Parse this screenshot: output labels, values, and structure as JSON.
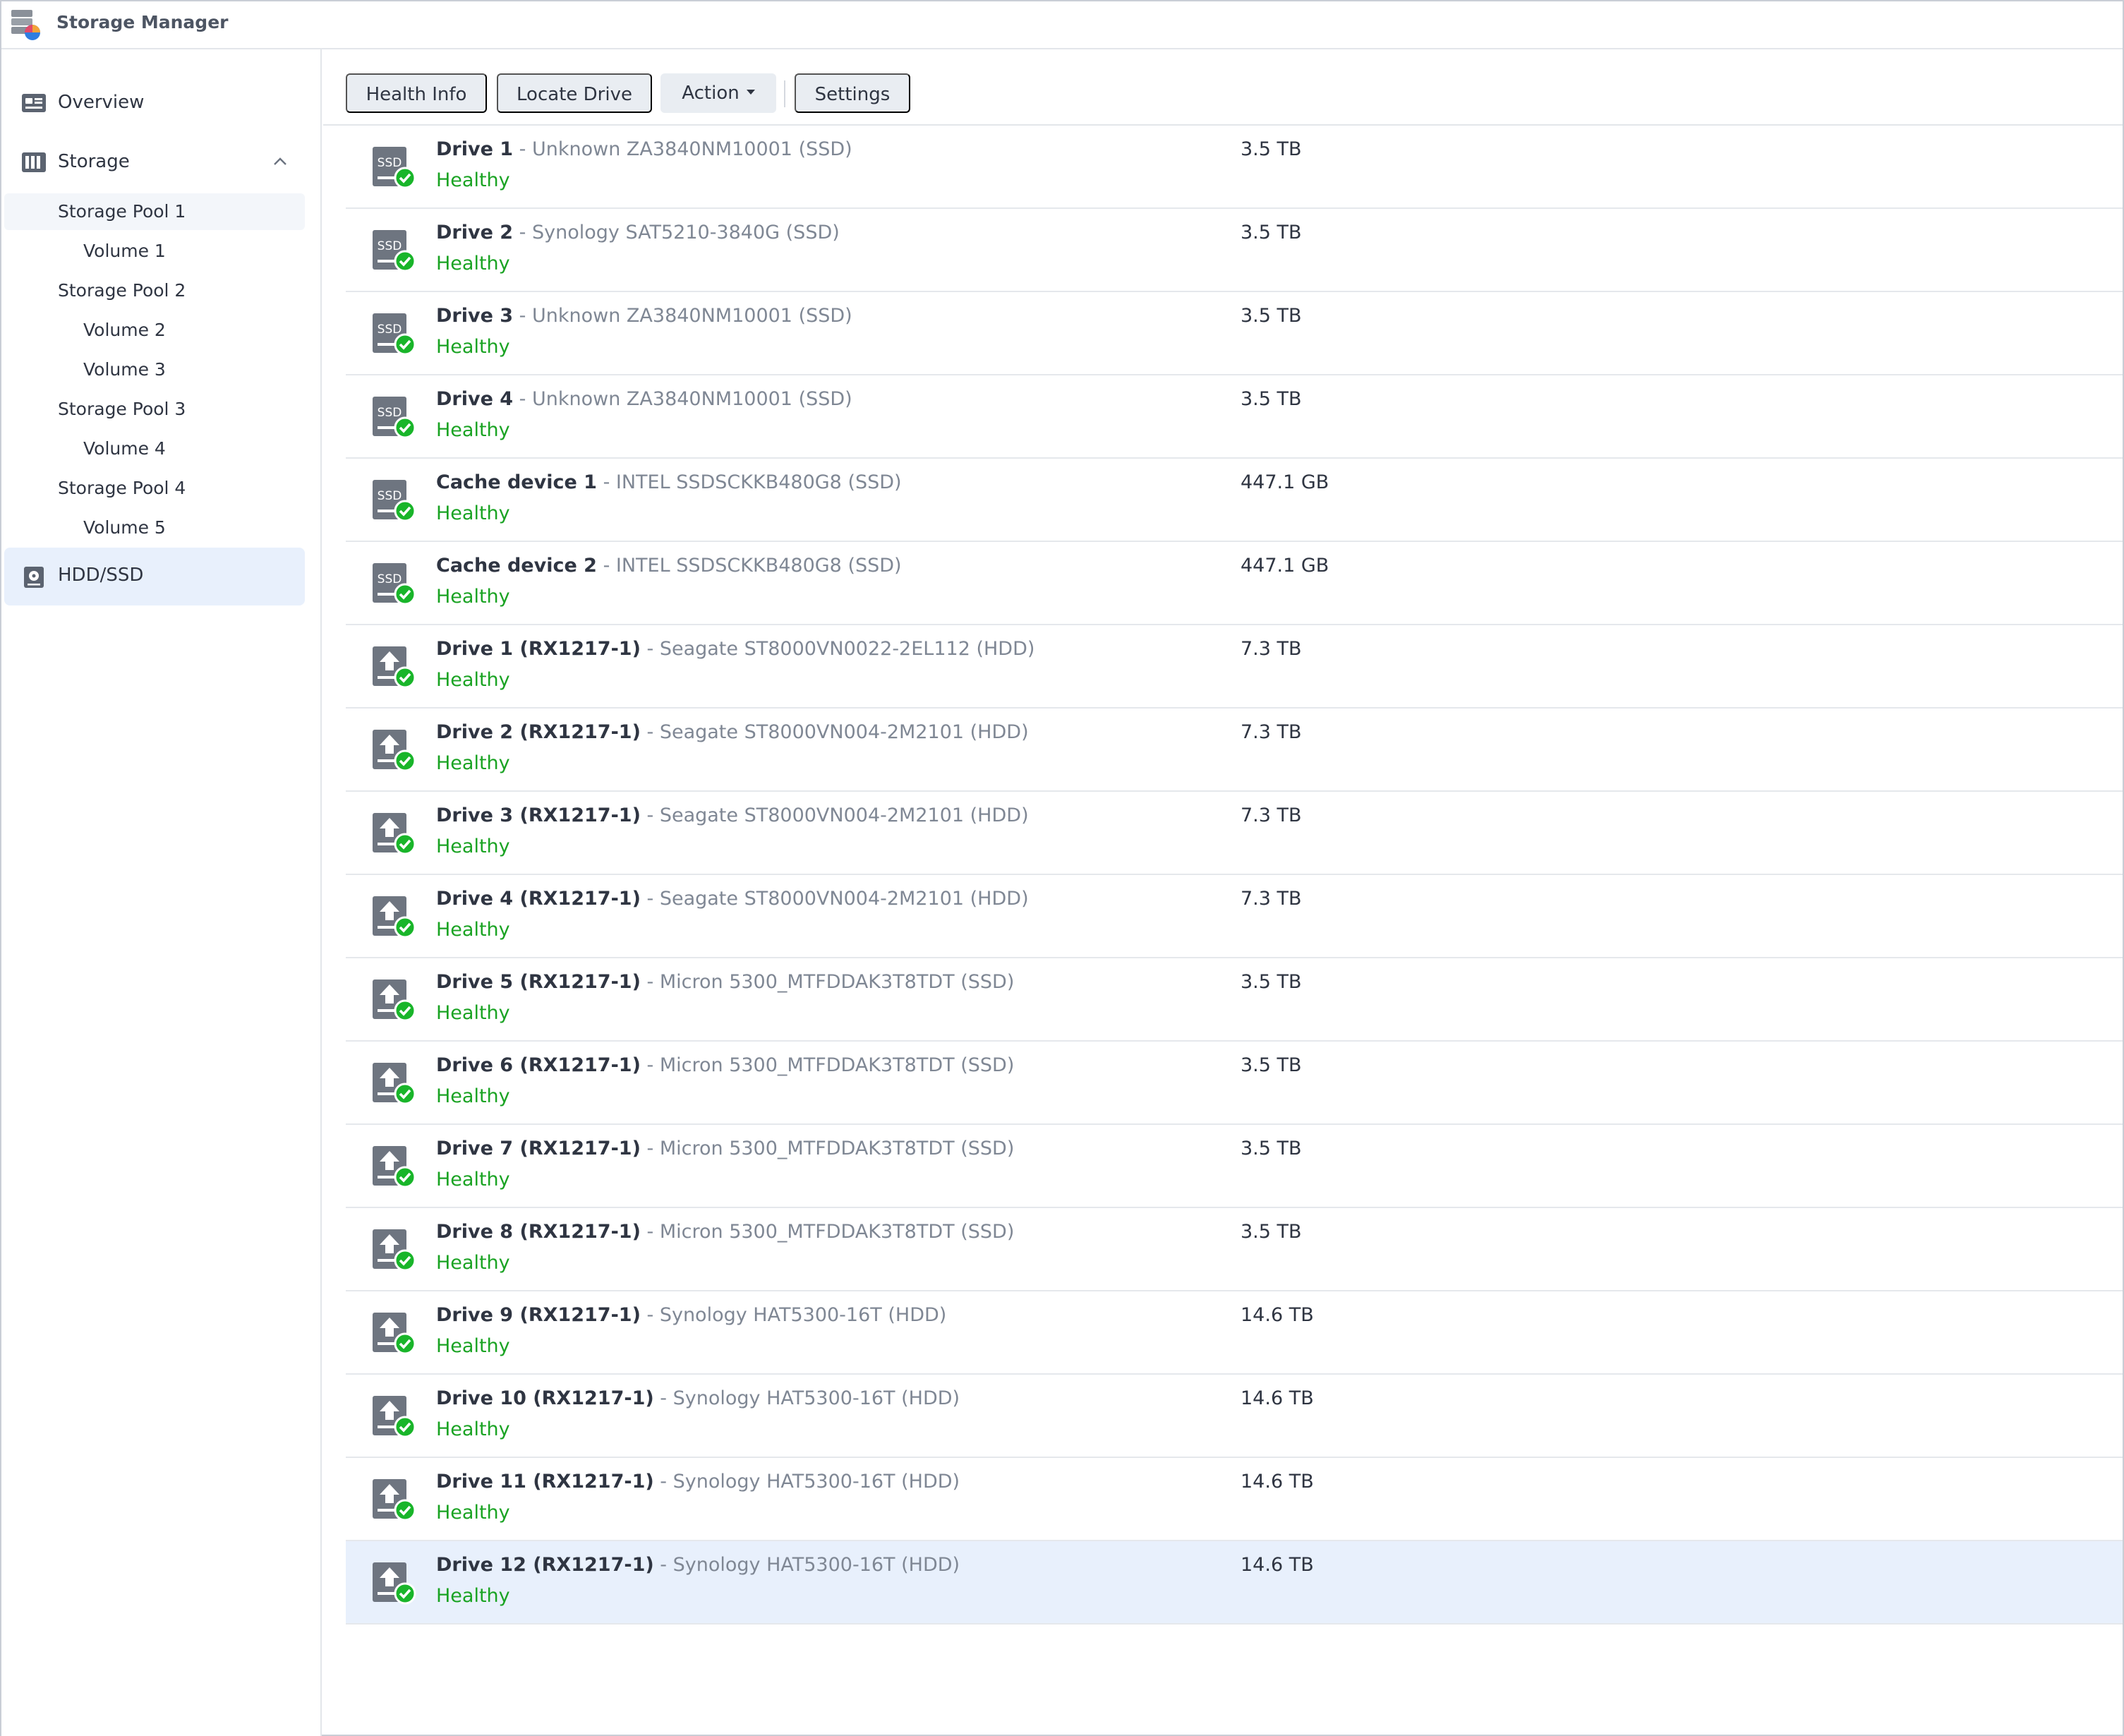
{
  "app": {
    "title": "Storage Manager"
  },
  "colors": {
    "accent": "#e8f0fc",
    "healthy": "#1aa323",
    "model_text": "#7f8794"
  },
  "sidebar": {
    "overview": {
      "label": "Overview",
      "icon": "overview-icon"
    },
    "storage": {
      "label": "Storage",
      "icon": "storage-icon",
      "expanded": true
    },
    "pools": [
      {
        "label": "Storage Pool 1",
        "volumes": [
          "Volume 1"
        ]
      },
      {
        "label": "Storage Pool 2",
        "volumes": [
          "Volume 2",
          "Volume 3"
        ]
      },
      {
        "label": "Storage Pool 3",
        "volumes": [
          "Volume 4"
        ]
      },
      {
        "label": "Storage Pool 4",
        "volumes": [
          "Volume 5"
        ]
      }
    ],
    "hdd_ssd": {
      "label": "HDD/SSD",
      "icon": "hdd-icon"
    }
  },
  "toolbar": {
    "health_info": "Health Info",
    "locate_drive": "Locate Drive",
    "action": "Action",
    "settings": "Settings"
  },
  "drives": [
    {
      "name": "Drive 1",
      "model": " - Unknown ZA3840NM10001 (SSD)",
      "status": "Healthy",
      "size": "3.5 TB",
      "kind": "ssd"
    },
    {
      "name": "Drive 2",
      "model": " - Synology SAT5210-3840G (SSD)",
      "status": "Healthy",
      "size": "3.5 TB",
      "kind": "ssd"
    },
    {
      "name": "Drive 3",
      "model": " - Unknown ZA3840NM10001 (SSD)",
      "status": "Healthy",
      "size": "3.5 TB",
      "kind": "ssd"
    },
    {
      "name": "Drive 4",
      "model": " - Unknown ZA3840NM10001 (SSD)",
      "status": "Healthy",
      "size": "3.5 TB",
      "kind": "ssd"
    },
    {
      "name": "Cache device 1",
      "model": " - INTEL SSDSCKKB480G8 (SSD)",
      "status": "Healthy",
      "size": "447.1 GB",
      "kind": "ssd"
    },
    {
      "name": "Cache device 2",
      "model": " - INTEL SSDSCKKB480G8 (SSD)",
      "status": "Healthy",
      "size": "447.1 GB",
      "kind": "ssd"
    },
    {
      "name": "Drive 1 (RX1217-1)",
      "model": " - Seagate ST8000VN0022-2EL112 (HDD)",
      "status": "Healthy",
      "size": "7.3 TB",
      "kind": "expansion"
    },
    {
      "name": "Drive 2 (RX1217-1)",
      "model": " - Seagate ST8000VN004-2M2101 (HDD)",
      "status": "Healthy",
      "size": "7.3 TB",
      "kind": "expansion"
    },
    {
      "name": "Drive 3 (RX1217-1)",
      "model": " - Seagate ST8000VN004-2M2101 (HDD)",
      "status": "Healthy",
      "size": "7.3 TB",
      "kind": "expansion"
    },
    {
      "name": "Drive 4 (RX1217-1)",
      "model": " - Seagate ST8000VN004-2M2101 (HDD)",
      "status": "Healthy",
      "size": "7.3 TB",
      "kind": "expansion"
    },
    {
      "name": "Drive 5 (RX1217-1)",
      "model": " - Micron 5300_MTFDDAK3T8TDT (SSD)",
      "status": "Healthy",
      "size": "3.5 TB",
      "kind": "expansion"
    },
    {
      "name": "Drive 6 (RX1217-1)",
      "model": " - Micron 5300_MTFDDAK3T8TDT (SSD)",
      "status": "Healthy",
      "size": "3.5 TB",
      "kind": "expansion"
    },
    {
      "name": "Drive 7 (RX1217-1)",
      "model": " - Micron 5300_MTFDDAK3T8TDT (SSD)",
      "status": "Healthy",
      "size": "3.5 TB",
      "kind": "expansion"
    },
    {
      "name": "Drive 8 (RX1217-1)",
      "model": " - Micron 5300_MTFDDAK3T8TDT (SSD)",
      "status": "Healthy",
      "size": "3.5 TB",
      "kind": "expansion"
    },
    {
      "name": "Drive 9 (RX1217-1)",
      "model": " - Synology HAT5300-16T (HDD)",
      "status": "Healthy",
      "size": "14.6 TB",
      "kind": "expansion"
    },
    {
      "name": "Drive 10 (RX1217-1)",
      "model": " - Synology HAT5300-16T (HDD)",
      "status": "Healthy",
      "size": "14.6 TB",
      "kind": "expansion"
    },
    {
      "name": "Drive 11 (RX1217-1)",
      "model": " - Synology HAT5300-16T (HDD)",
      "status": "Healthy",
      "size": "14.6 TB",
      "kind": "expansion"
    },
    {
      "name": "Drive 12 (RX1217-1)",
      "model": " - Synology HAT5300-16T (HDD)",
      "status": "Healthy",
      "size": "14.6 TB",
      "kind": "expansion",
      "selected": true
    }
  ],
  "icons": {
    "ssd_badge": "SSD"
  }
}
